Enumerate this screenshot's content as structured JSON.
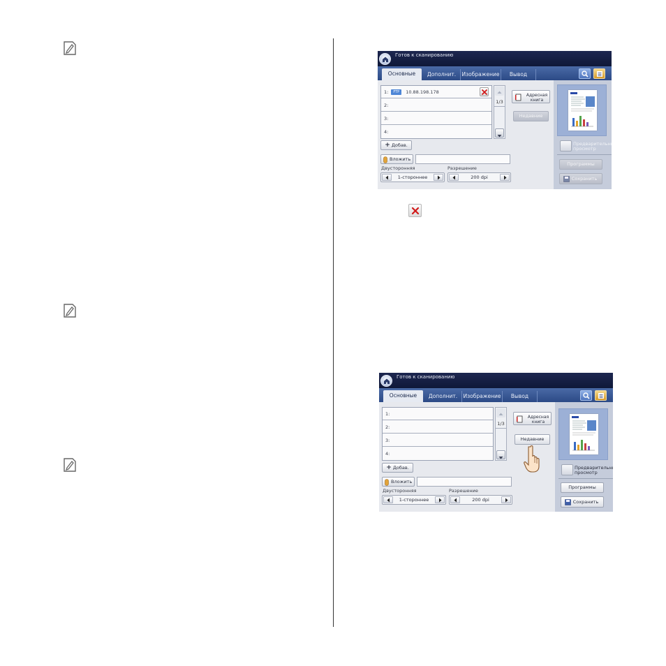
{
  "panel1": {
    "status": "Готов к сканированию",
    "tabs": [
      "Основные",
      "Дополнит.",
      "Изображение",
      "Вывод"
    ],
    "rows": [
      {
        "num": "1:",
        "protocol": "FTP",
        "value": "10.88.198.178"
      },
      {
        "num": "2:",
        "protocol": "",
        "value": ""
      },
      {
        "num": "3:",
        "protocol": "",
        "value": ""
      },
      {
        "num": "4:",
        "protocol": "",
        "value": ""
      }
    ],
    "page": "1/3",
    "address_book": "Адресная книга",
    "recent": "Недавние",
    "add": "Добав.",
    "attach": "Вложить",
    "duplex_label": "Двусторонняя",
    "duplex_value": "1-стороннее",
    "resolution_label": "Разрешение",
    "resolution_value": "200 dpi",
    "preview": "Предварительный просмотр",
    "programs": "Программы",
    "save": "Сохранить"
  },
  "panel2": {
    "status": "Готов к сканированию",
    "tabs": [
      "Основные",
      "Дополнит.",
      "Изображение",
      "Вывод"
    ],
    "rows": [
      {
        "num": "1:",
        "protocol": "",
        "value": ""
      },
      {
        "num": "2:",
        "protocol": "",
        "value": ""
      },
      {
        "num": "3:",
        "protocol": "",
        "value": ""
      },
      {
        "num": "4:",
        "protocol": "",
        "value": ""
      }
    ],
    "page": "1/3",
    "address_book": "Адресная книга",
    "recent": "Недавние",
    "add": "Добав.",
    "attach": "Вложить",
    "duplex_label": "Двусторонняя",
    "duplex_value": "1-стороннее",
    "resolution_label": "Разрешение",
    "resolution_value": "200 dpi",
    "preview": "Предварительный просмотр",
    "programs": "Программы",
    "save": "Сохранить"
  },
  "colors": {
    "titlebar": "#1d2750",
    "tabbar": "#3a5a98",
    "delete_red": "#d11a1a"
  },
  "icons": [
    "note-icon",
    "delete-icon",
    "home-icon",
    "zoom-icon",
    "job-status-icon",
    "address-book-icon",
    "paperclip-icon",
    "save-icon",
    "hand-pointer-icon"
  ]
}
